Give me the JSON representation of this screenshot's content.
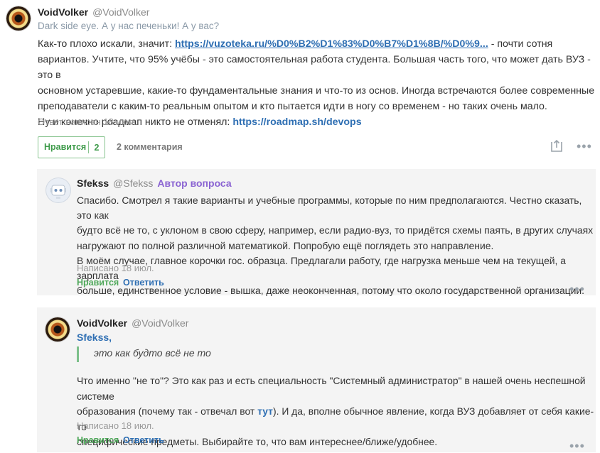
{
  "answer": {
    "author_name": "VoidVolker",
    "author_handle": "@VoidVolker",
    "subtitle": "Dark side eye. А у нас печеньки! А у вас?",
    "line1_prefix": "Как-то плохо искали, значит: ",
    "line1_link": "https://vuzoteka.ru/%D0%B2%D1%83%D0%B7%D1%8B/%D0%9...",
    "line1_suffix": " - почти сотня",
    "line2": "вариантов. Учтите, что 95% учёбы - это самостоятельная работа студента. Большая часть того, что может дать ВУЗ - это в",
    "line3": "основном устаревшие, какие-то фундаментальные знания и что-то из основ. Иногда встречаются более современные",
    "line4": "преподаватели с каким-то реальным опытом и кто пытается идти в ногу со временем - но таких очень мало.",
    "line5_prefix": "Ну и конечно роадмап никто не отменял: ",
    "line5_link": "https://roadmap.sh/devops",
    "meta": "Ответ написан 18 июл.",
    "like_label": "Нравится",
    "like_count": "2",
    "comments_label": "2 комментария",
    "more_label": "•••"
  },
  "comments": [
    {
      "author_name": "Sfekss",
      "author_handle": "@Sfekss",
      "author_tag": "Автор вопроса",
      "lines": [
        "Спасибо. Смотрел я такие варианты и учебные программы, которые по ним предполагаются. Честно сказать, это как",
        "будто всё не то, с уклоном в свою сферу, например, если радио-вуз, то придётся схемы паять, в других случаях",
        "нагружают по полной различной математикой. Попробую ещё поглядеть это направление.",
        "В моём случае, главное корочки гос. образца. Предлагали работу, где нагрузка меньше чем на текущей, а зарплата",
        "больше, единственное условие - вышка, даже неоконченная, потому что около государственной организации."
      ],
      "meta": "Написано 18 июл.",
      "like_label": "Нравится",
      "reply_label": "Ответить",
      "more_label": "•••"
    },
    {
      "author_name": "VoidVolker",
      "author_handle": "@VoidVolker",
      "quote_name": "Sfekss,",
      "quote_text": "это как будто всё не то",
      "line1": "Что именно \"не то\"? Это как раз и есть специальность \"Системный администратор\" в нашей очень неспешной системе",
      "line2_prefix": "образования (почему так - отвечал вот ",
      "line2_link": "тут",
      "line2_suffix": "). И да, вполне обычное явление, когда ВУЗ добавляет от себя какие-то",
      "line3": "специфические предметы. Выбирайте то, что вам интереснее/ближе/удобнее.",
      "meta": "Написано 18 июл.",
      "like_label": "Нравится",
      "reply_label": "Ответить",
      "more_label": "•••"
    }
  ]
}
